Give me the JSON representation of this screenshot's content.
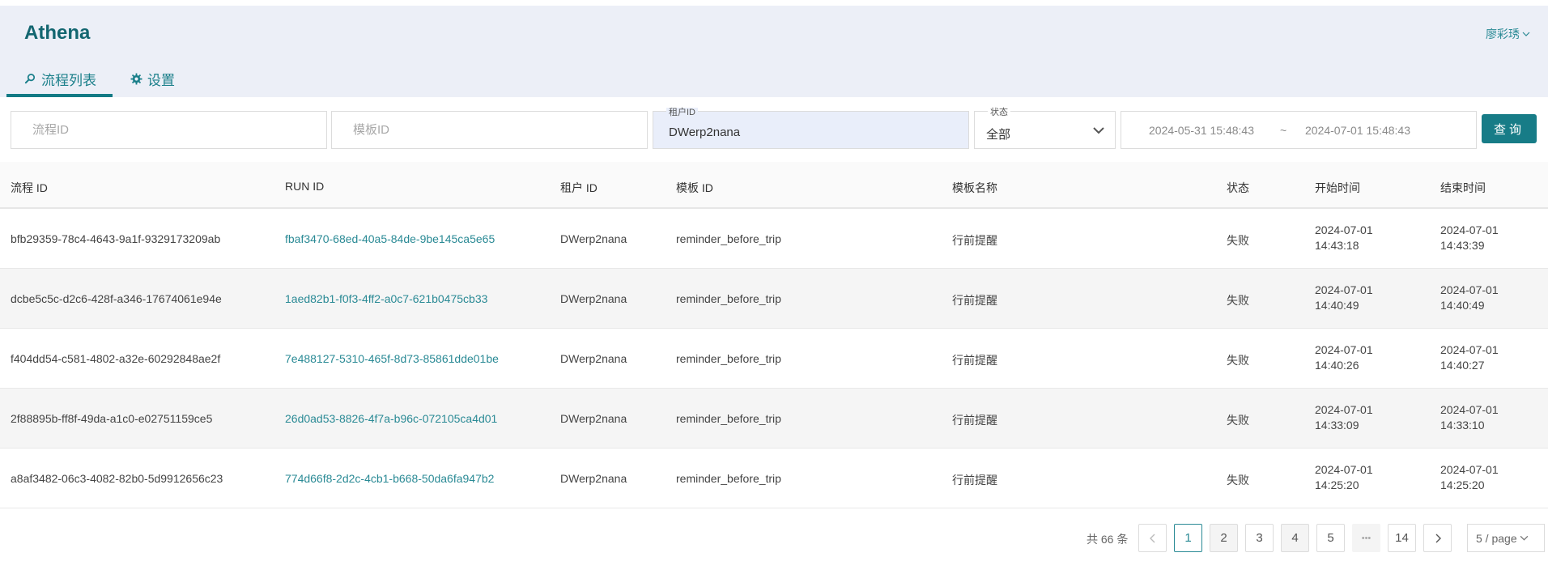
{
  "app": {
    "title": "Athena",
    "user": "廖彩琇"
  },
  "tabs": [
    {
      "label": "流程列表",
      "icon": "search-icon",
      "active": true
    },
    {
      "label": "设置",
      "icon": "gear-icon",
      "active": false
    }
  ],
  "filters": {
    "process_id": {
      "placeholder": "流程ID",
      "value": ""
    },
    "template_id": {
      "placeholder": "模板ID",
      "value": ""
    },
    "tenant_id": {
      "label": "租户ID",
      "value": "DWerp2nana"
    },
    "status": {
      "label": "状态",
      "value": "全部"
    },
    "date_start": "2024-05-31 15:48:43",
    "date_sep": "~",
    "date_end": "2024-07-01 15:48:43",
    "query_label": "查询"
  },
  "table": {
    "headers": [
      "流程 ID",
      "RUN ID",
      "租户 ID",
      "模板 ID",
      "模板名称",
      "状态",
      "开始时间",
      "结束时间"
    ],
    "rows": [
      {
        "process_id": "bfb29359-78c4-4643-9a1f-9329173209ab",
        "run_id": "fbaf3470-68ed-40a5-84de-9be145ca5e65",
        "tenant_id": "DWerp2nana",
        "template_id": "reminder_before_trip",
        "template_name": "行前提醒",
        "status": "失败",
        "start_date": "2024-07-01",
        "start_time": "14:43:18",
        "end_date": "2024-07-01",
        "end_time": "14:43:39"
      },
      {
        "process_id": "dcbe5c5c-d2c6-428f-a346-17674061e94e",
        "run_id": "1aed82b1-f0f3-4ff2-a0c7-621b0475cb33",
        "tenant_id": "DWerp2nana",
        "template_id": "reminder_before_trip",
        "template_name": "行前提醒",
        "status": "失败",
        "start_date": "2024-07-01",
        "start_time": "14:40:49",
        "end_date": "2024-07-01",
        "end_time": "14:40:49"
      },
      {
        "process_id": "f404dd54-c581-4802-a32e-60292848ae2f",
        "run_id": "7e488127-5310-465f-8d73-85861dde01be",
        "tenant_id": "DWerp2nana",
        "template_id": "reminder_before_trip",
        "template_name": "行前提醒",
        "status": "失败",
        "start_date": "2024-07-01",
        "start_time": "14:40:26",
        "end_date": "2024-07-01",
        "end_time": "14:40:27"
      },
      {
        "process_id": "2f88895b-ff8f-49da-a1c0-e02751159ce5",
        "run_id": "26d0ad53-8826-4f7a-b96c-072105ca4d01",
        "tenant_id": "DWerp2nana",
        "template_id": "reminder_before_trip",
        "template_name": "行前提醒",
        "status": "失败",
        "start_date": "2024-07-01",
        "start_time": "14:33:09",
        "end_date": "2024-07-01",
        "end_time": "14:33:10"
      },
      {
        "process_id": "a8af3482-06c3-4082-82b0-5d9912656c23",
        "run_id": "774d66f8-2d2c-4cb1-b668-50da6fa947b2",
        "tenant_id": "DWerp2nana",
        "template_id": "reminder_before_trip",
        "template_name": "行前提醒",
        "status": "失败",
        "start_date": "2024-07-01",
        "start_time": "14:25:20",
        "end_date": "2024-07-01",
        "end_time": "14:25:20"
      }
    ]
  },
  "pagination": {
    "total": "共 66 条",
    "pages": [
      "1",
      "2",
      "3",
      "4",
      "5"
    ],
    "ellipsis": "•••",
    "last_page": "14",
    "current": "1",
    "per_page": "5 / page"
  }
}
